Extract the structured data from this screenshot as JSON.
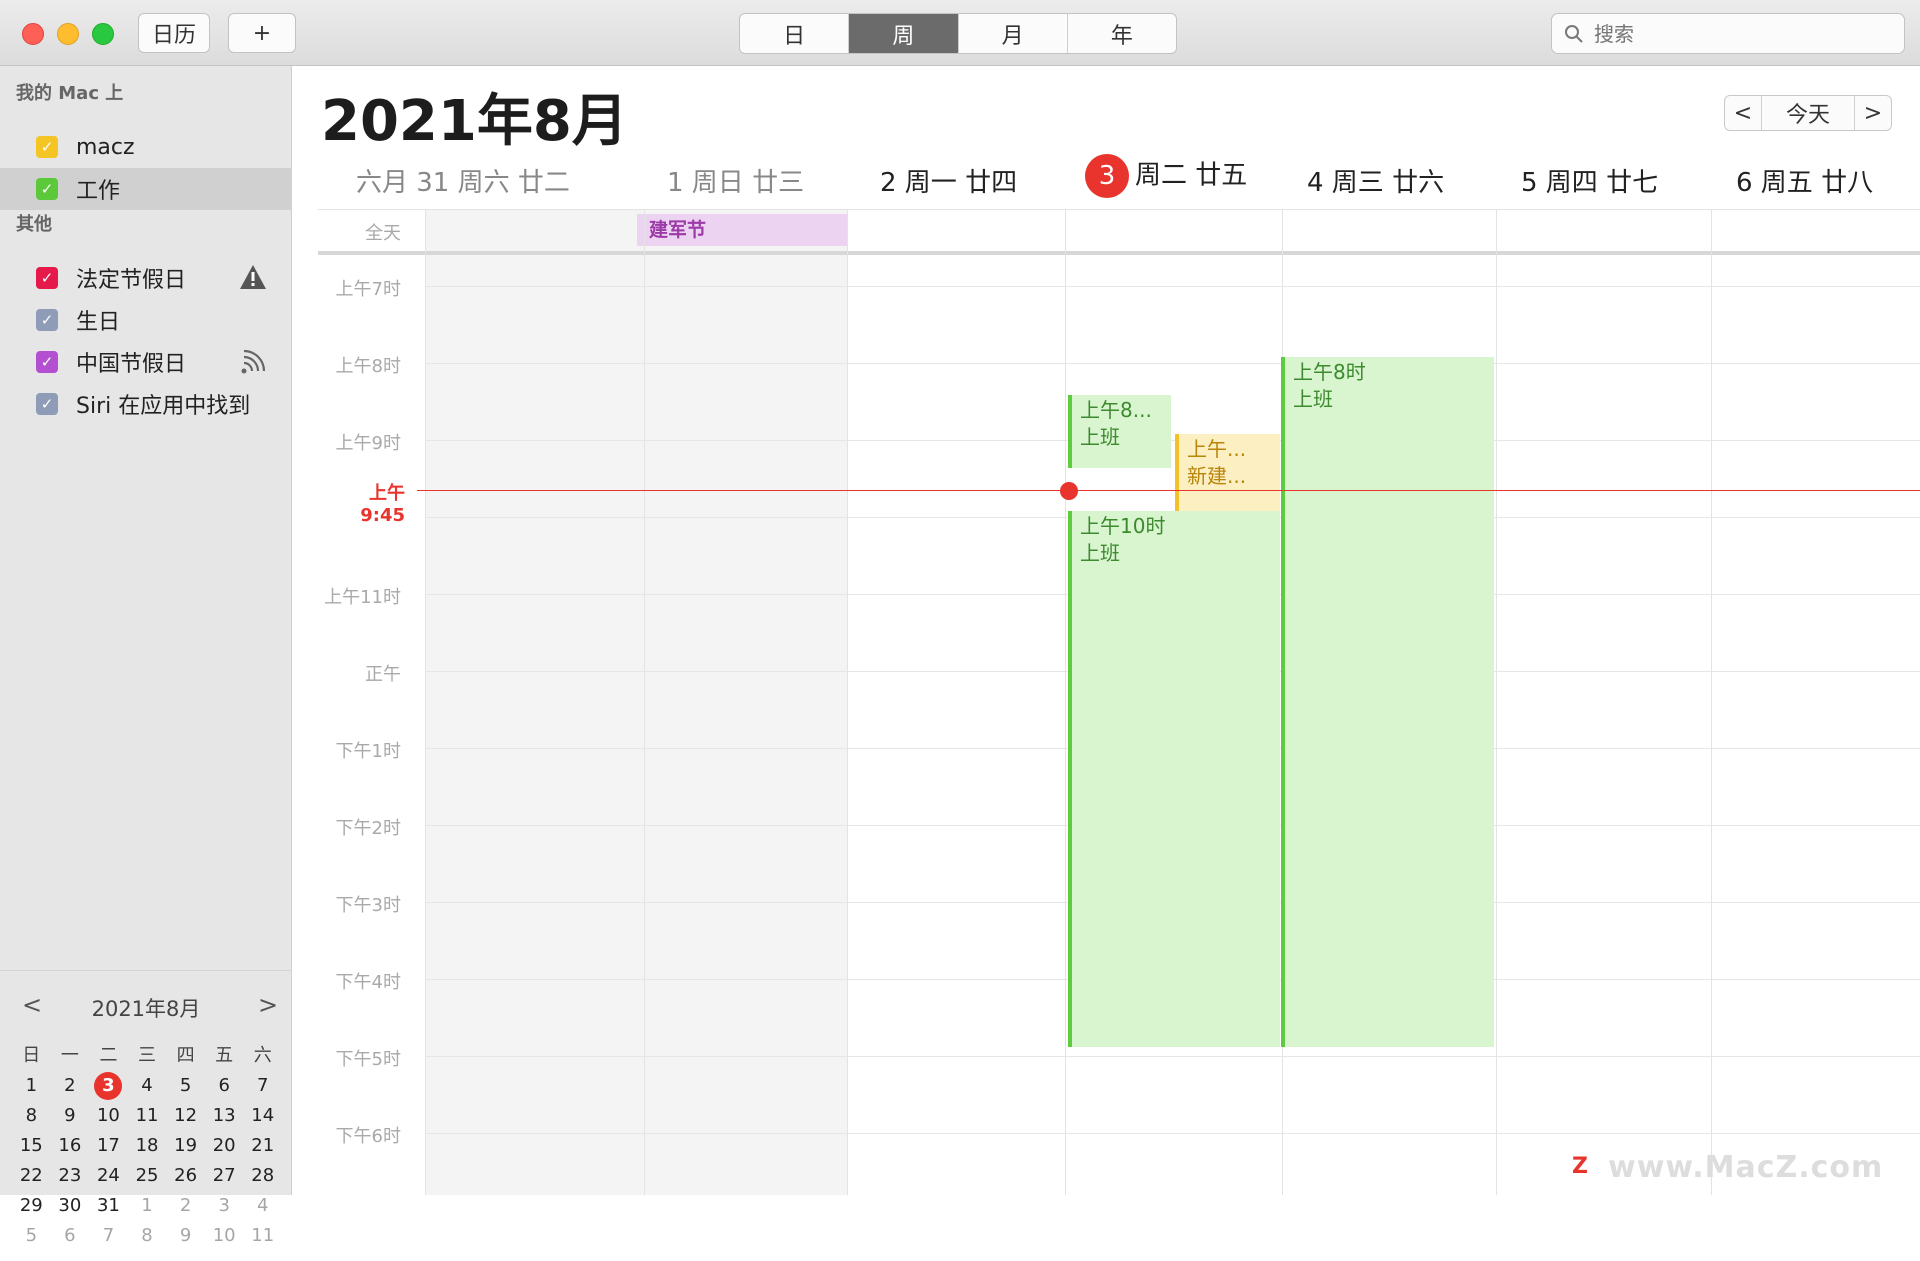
{
  "toolbar": {
    "calendars_label": "日历",
    "add_label": "+"
  },
  "views": [
    {
      "label": "日"
    },
    {
      "label": "周"
    },
    {
      "label": "月"
    },
    {
      "label": "年"
    }
  ],
  "search": {
    "placeholder": "搜索"
  },
  "sidebar": {
    "section1": "我的 Mac 上",
    "section2": "其他",
    "items": [
      {
        "label": "macz",
        "color": "#f5c525"
      },
      {
        "label": "工作",
        "color": "#5cc93b"
      },
      {
        "label": "法定节假日",
        "color": "#e5194a"
      },
      {
        "label": "生日",
        "color": "#8e9cb8"
      },
      {
        "label": "中国节假日",
        "color": "#b34fd1"
      },
      {
        "label": "Siri 在应用中找到",
        "color": "#8e9cb8"
      }
    ]
  },
  "mini": {
    "title": "2021年8月",
    "prev": "<",
    "next": ">",
    "weekdays": [
      "日",
      "一",
      "二",
      "三",
      "四",
      "五",
      "六"
    ],
    "weeks": [
      [
        "1",
        "2",
        "3",
        "4",
        "5",
        "6",
        "7"
      ],
      [
        "8",
        "9",
        "10",
        "11",
        "12",
        "13",
        "14"
      ],
      [
        "15",
        "16",
        "17",
        "18",
        "19",
        "20",
        "21"
      ],
      [
        "22",
        "23",
        "24",
        "25",
        "26",
        "27",
        "28"
      ],
      [
        "29",
        "30",
        "31",
        "1",
        "2",
        "3",
        "4"
      ],
      [
        "5",
        "6",
        "7",
        "8",
        "9",
        "10",
        "11"
      ]
    ]
  },
  "main": {
    "title": "2021年8月",
    "today_label": "今天",
    "prev": "<",
    "next": ">",
    "days": [
      {
        "text": "六月  31 周六   廿二"
      },
      {
        "text": "1 周日   廿三"
      },
      {
        "text": "2 周一   廿四"
      },
      {
        "num": "3",
        "text": "周二  廿五"
      },
      {
        "text": "4 周三   廿六"
      },
      {
        "text": "5 周四   廿七"
      },
      {
        "text": "6 周五   廿八"
      }
    ],
    "allday_label": "全天",
    "hours": [
      "上午7时",
      "上午8时",
      "上午9时",
      "上午11时",
      "正午",
      "下午1时",
      "下午2时",
      "下午3时",
      "下午4时",
      "下午5时",
      "下午6时"
    ],
    "now_label": "上午9:45",
    "events": {
      "allday": "建军节",
      "e1_time": "上午8...",
      "e1_title": "上班",
      "e2_time": "上午...",
      "e2_title": "新建...",
      "e3_time": "上午10时",
      "e3_title": "上班",
      "e4_time": "上午8时",
      "e4_title": "上班"
    }
  },
  "watermark": "www.MacZ.com"
}
